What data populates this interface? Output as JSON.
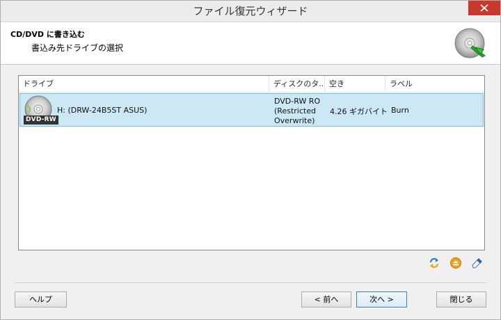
{
  "window": {
    "title": "ファイル復元ウィザード"
  },
  "header": {
    "title": "CD/DVD に書き込む",
    "subtitle": "書込み先ドライブの選択"
  },
  "drive_list": {
    "columns": [
      "ドライブ",
      "ディスクのタ...",
      "空き",
      "ラベル"
    ],
    "rows": [
      {
        "drive": "H: (DRW-24B5ST ASUS)",
        "disc_type_line1": "DVD-RW RO",
        "disc_type_line2": "(Restricted",
        "disc_type_line3": "Overwrite)",
        "free": "4.26 ギガバイト",
        "label": "Burn",
        "badge": "DVD-RW"
      }
    ]
  },
  "buttons": {
    "help": "ヘルプ",
    "back": "< 前へ",
    "next": "次へ >",
    "close": "閉じる"
  },
  "colors": {
    "selection": "#cce8f4",
    "close_button": "#c7392b",
    "refresh_icon": "#2b7fd4",
    "eject_icon": "#f0a020"
  }
}
